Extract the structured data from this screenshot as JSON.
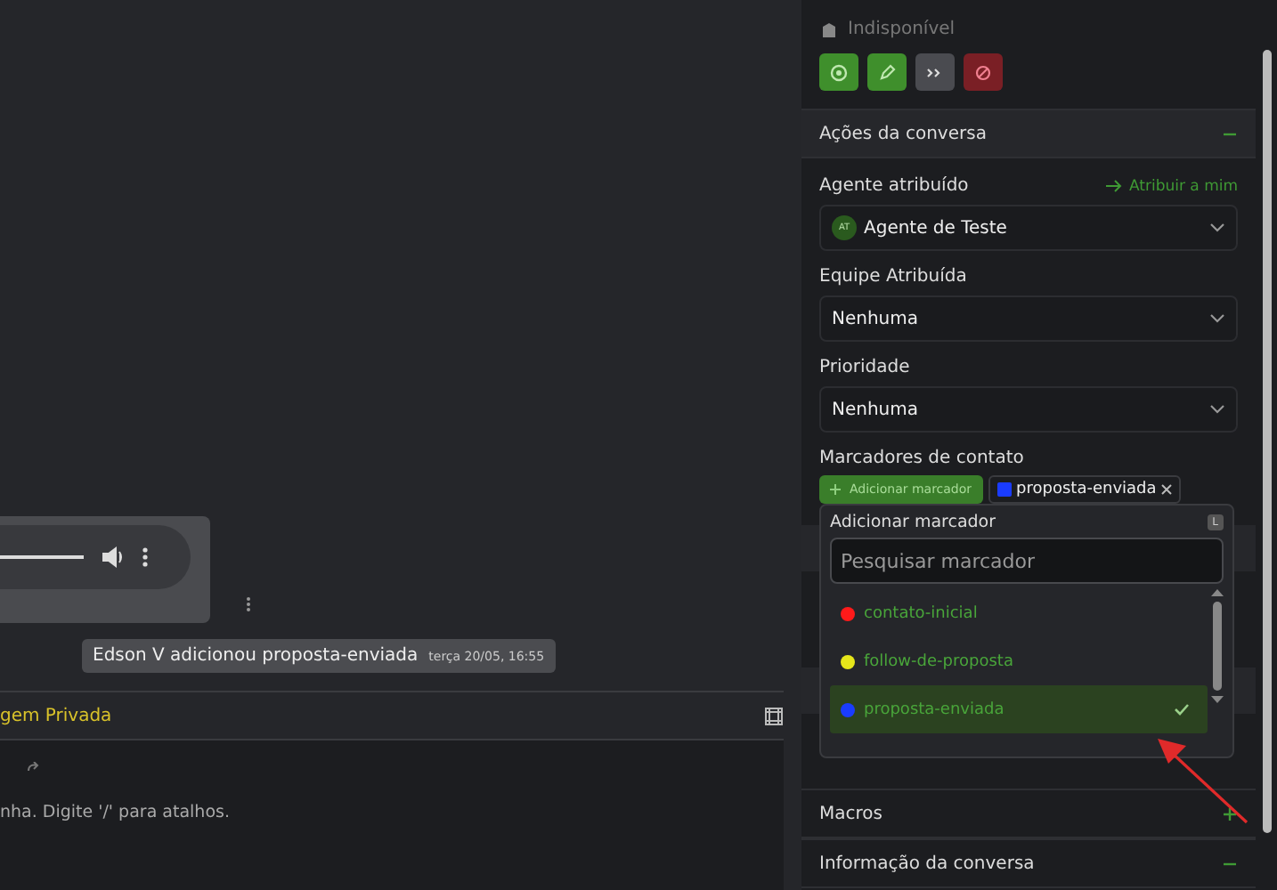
{
  "chat": {
    "system_message": {
      "text": "Edson V adicionou proposta-enviada",
      "time": "terça 20/05, 16:55"
    },
    "reply_tab": "gem Privada",
    "editor_placeholder": "nha. Digite '/' para atalhos."
  },
  "contact": {
    "status": "Indisponível",
    "action_buttons": [
      {
        "kind": "target",
        "color": "#3f8f2c"
      },
      {
        "kind": "edit",
        "color": "#3f8f2c"
      },
      {
        "kind": "merge",
        "color": "#4a4b50"
      },
      {
        "kind": "block",
        "color": "#7a1f25"
      }
    ]
  },
  "actions_section": {
    "title": "Ações da conversa",
    "expanded": true,
    "agent": {
      "label": "Agente atribuído",
      "assign_link": "Atribuir a mim",
      "initials": "AT",
      "value": "Agente de Teste"
    },
    "team": {
      "label": "Equipe Atribuída",
      "value": "Nenhuma"
    },
    "priority": {
      "label": "Prioridade",
      "value": "Nenhuma"
    },
    "labels": {
      "label": "Marcadores de contato",
      "add_button": "Adicionar marcador",
      "tags": [
        {
          "text": "proposta-enviada",
          "color": "#1a3cff"
        }
      ]
    }
  },
  "label_popup": {
    "title": "Adicionar marcador",
    "shortcut": "L",
    "search_placeholder": "Pesquisar marcador",
    "options": [
      {
        "text": "contato-inicial",
        "color": "#ff1a1a",
        "selected": false
      },
      {
        "text": "follow-de-proposta",
        "color": "#e6e61a",
        "selected": false
      },
      {
        "text": "proposta-enviada",
        "color": "#1a3cff",
        "selected": true
      }
    ]
  },
  "sections": [
    {
      "title": "Macros",
      "expanded": false
    },
    {
      "title": "Informação da conversa",
      "expanded": true
    }
  ]
}
